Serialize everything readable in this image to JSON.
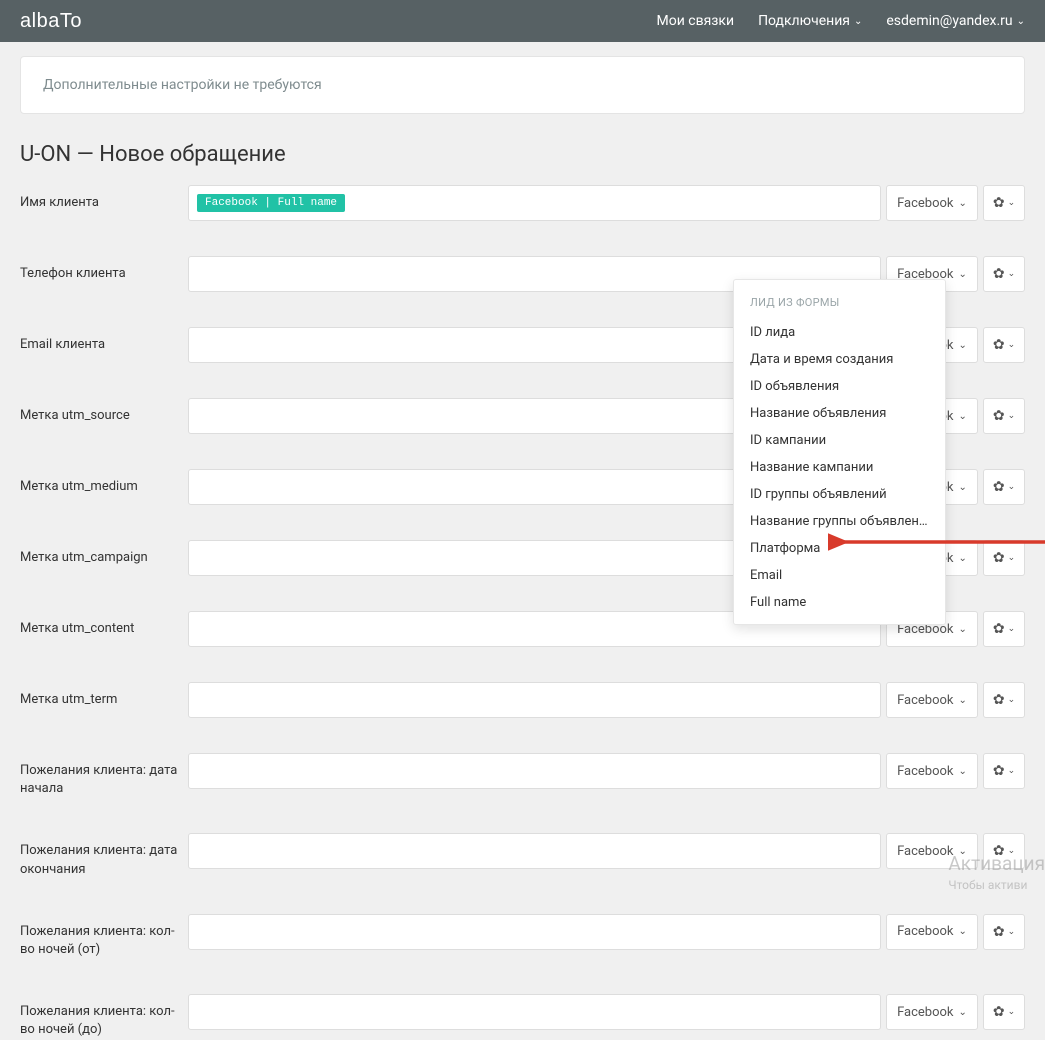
{
  "brand": "albaTo",
  "nav": {
    "links": "Мои связки",
    "connections": "Подключения",
    "user": "esdemin@yandex.ru"
  },
  "notice": "Дополнительные настройки не требуются",
  "page_title": "U-ON — Новое обращение",
  "source_label": "Facebook",
  "token_text": "Facebook | Full name",
  "fields": [
    {
      "label": "Имя клиента"
    },
    {
      "label": "Телефон клиента"
    },
    {
      "label": "Email клиента"
    },
    {
      "label": "Метка utm_source"
    },
    {
      "label": "Метка utm_medium"
    },
    {
      "label": "Метка utm_campaign"
    },
    {
      "label": "Метка utm_content"
    },
    {
      "label": "Метка utm_term"
    },
    {
      "label": "Пожелания клиента: дата начала"
    },
    {
      "label": "Пожелания клиента: дата окончания"
    },
    {
      "label": "Пожелания клиента: кол-во ночей (от)"
    },
    {
      "label": "Пожелания клиента: кол-во ночей (до)"
    }
  ],
  "dropdown": {
    "header": "ЛИД ИЗ ФОРМЫ",
    "items": [
      "ID лида",
      "Дата и время создания",
      "ID объявления",
      "Название объявления",
      "ID кампании",
      "Название кампании",
      "ID группы объявлений",
      "Название группы объявлений",
      "Платформа",
      "Email",
      "Full name"
    ]
  },
  "watermark": {
    "line1": "Активация",
    "line2": "Чтобы активи"
  },
  "colors": {
    "header_bg": "#576164",
    "page_bg": "#f0f0f0",
    "token_bg": "#21c2a6",
    "arrow": "#d83a2b"
  }
}
